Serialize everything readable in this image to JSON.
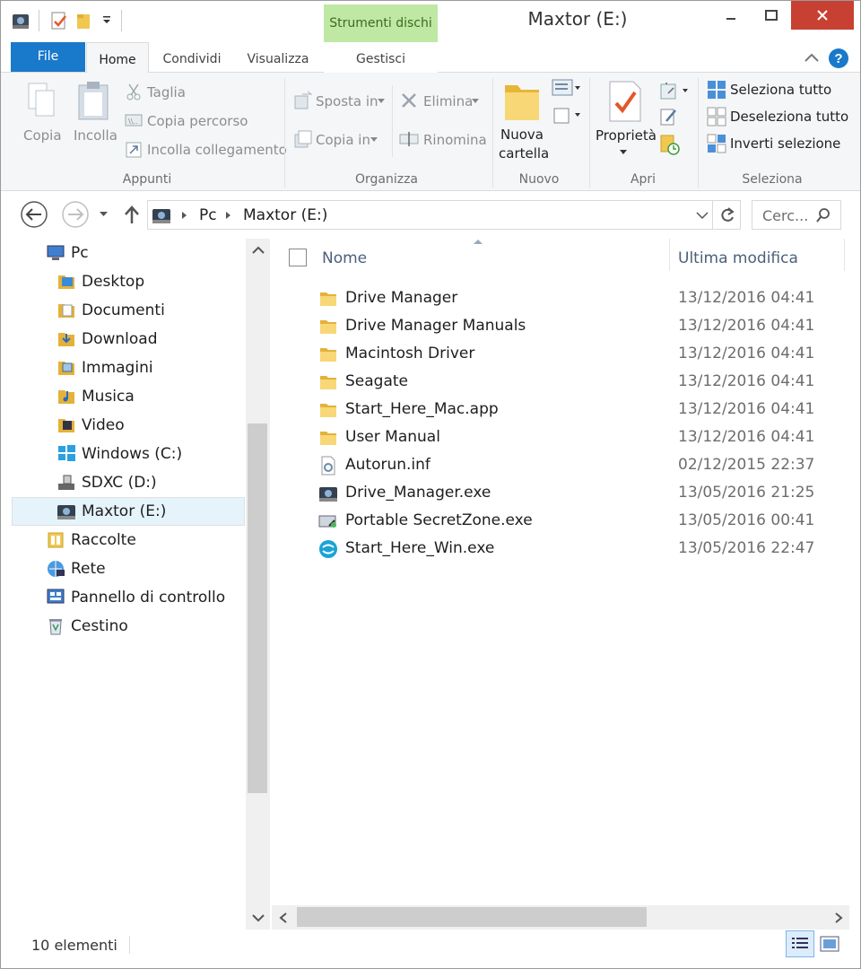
{
  "window": {
    "title": "Maxtor (E:)",
    "context_tab": "Strumenti dischi"
  },
  "tabs": [
    {
      "label": "File"
    },
    {
      "label": "Home"
    },
    {
      "label": "Condividi"
    },
    {
      "label": "Visualizza"
    },
    {
      "label": "Gestisci"
    }
  ],
  "ribbon": {
    "appunti": {
      "label": "Appunti",
      "copia": "Copia",
      "incolla": "Incolla",
      "taglia": "Taglia",
      "copia_percorso": "Copia percorso",
      "incolla_collegamento": "Incolla collegamento"
    },
    "organizza": {
      "label": "Organizza",
      "sposta_in": "Sposta in",
      "copia_in": "Copia in",
      "elimina": "Elimina",
      "rinomina": "Rinomina"
    },
    "nuovo": {
      "label": "Nuovo",
      "nuova_cartella_1": "Nuova",
      "nuova_cartella_2": "cartella"
    },
    "apri": {
      "label": "Apri",
      "proprieta": "Proprietà"
    },
    "seleziona": {
      "label": "Seleziona",
      "seleziona_tutto": "Seleziona tutto",
      "deseleziona_tutto": "Deseleziona tutto",
      "inverti_selezione": "Inverti selezione"
    }
  },
  "address": {
    "crumbs": [
      "Pc",
      "Maxtor (E:)"
    ],
    "search_placeholder": "Cerc..."
  },
  "nav": [
    {
      "label": "Pc",
      "icon": "pc-icon"
    },
    {
      "label": "Desktop",
      "icon": "desktop-icon"
    },
    {
      "label": "Documenti",
      "icon": "documents-icon"
    },
    {
      "label": "Download",
      "icon": "download-icon"
    },
    {
      "label": "Immagini",
      "icon": "pictures-icon"
    },
    {
      "label": "Musica",
      "icon": "music-icon"
    },
    {
      "label": "Video",
      "icon": "video-icon"
    },
    {
      "label": "Windows (C:)",
      "icon": "windows-drive-icon"
    },
    {
      "label": "SDXC (D:)",
      "icon": "usb-drive-icon"
    },
    {
      "label": "Maxtor (E:)",
      "icon": "drive-icon"
    },
    {
      "label": "Raccolte",
      "icon": "libraries-icon"
    },
    {
      "label": "Rete",
      "icon": "network-icon"
    },
    {
      "label": "Pannello di controllo",
      "icon": "control-panel-icon"
    },
    {
      "label": "Cestino",
      "icon": "recycle-bin-icon"
    }
  ],
  "columns": {
    "name": "Nome",
    "modified": "Ultima modifica"
  },
  "files": [
    {
      "name": "Drive Manager",
      "date": "13/12/2016 04:41",
      "icon": "folder-icon"
    },
    {
      "name": "Drive Manager Manuals",
      "date": "13/12/2016 04:41",
      "icon": "folder-icon"
    },
    {
      "name": "Macintosh Driver",
      "date": "13/12/2016 04:41",
      "icon": "folder-icon"
    },
    {
      "name": "Seagate",
      "date": "13/12/2016 04:41",
      "icon": "folder-icon"
    },
    {
      "name": "Start_Here_Mac.app",
      "date": "13/12/2016 04:41",
      "icon": "folder-icon"
    },
    {
      "name": "User Manual",
      "date": "13/12/2016 04:41",
      "icon": "folder-icon"
    },
    {
      "name": "Autorun.inf",
      "date": "02/12/2015 22:37",
      "icon": "settings-file-icon"
    },
    {
      "name": "Drive_Manager.exe",
      "date": "13/05/2016 21:25",
      "icon": "drive-exe-icon"
    },
    {
      "name": "Portable SecretZone.exe",
      "date": "13/05/2016 00:41",
      "icon": "secretzone-exe-icon"
    },
    {
      "name": "Start_Here_Win.exe",
      "date": "13/05/2016 22:47",
      "icon": "seagate-exe-icon"
    }
  ],
  "status": {
    "count": "10 elementi"
  },
  "colors": {
    "accent": "#1979ca",
    "context_tab": "#bfe8a4",
    "close": "#c84031",
    "selected": "#e5f3fb"
  }
}
